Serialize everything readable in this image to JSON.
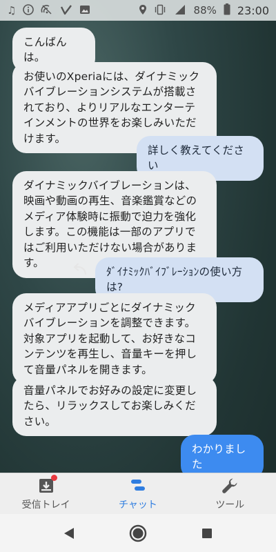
{
  "status_bar": {
    "icons_left": [
      "music-note-icon",
      "info-icon",
      "vpn-icon",
      "signal-v-icon",
      "image-icon"
    ],
    "icons_right": [
      "location-icon",
      "vibrate-icon",
      "cellular-4g-icon"
    ],
    "battery": "88%",
    "time": "23:00"
  },
  "chat": {
    "messages": [
      {
        "from": "bot",
        "text": "こんばんは。"
      },
      {
        "from": "bot",
        "text": "お使いのXperiaには、ダイナミックバイブレーションシステムが搭載されており、よりリアルなエンターテインメントの世界をお楽しみいただけます。"
      },
      {
        "from": "user",
        "text": "詳しく教えてください"
      },
      {
        "from": "bot",
        "text": "ダイナミックバイブレーションは、映画や動画の再生、音楽鑑賞などのメディア体験時に振動で迫力を強化します。この機能は一部のアプリではご利用いただけない場合があります。"
      },
      {
        "from": "user",
        "text": "ﾀﾞｲﾅﾐｯｸﾊﾞｲﾌﾞﾚｰｼｮﾝの使い方は?"
      },
      {
        "from": "bot",
        "text": "メディアアプリごとにダイナミックバイブレーションを調整できます。対象アプリを起動して、お好きなコンテンツを再生し、音量キーを押して音量パネルを開きます。"
      },
      {
        "from": "bot",
        "text": "音量パネルでお好みの設定に変更したら、リラックスしてお楽しみください。"
      },
      {
        "from": "user",
        "text": "わかりました"
      }
    ]
  },
  "tab_bar": {
    "tabs": [
      {
        "label": "受信トレイ",
        "icon": "inbox-icon",
        "active": false,
        "badge": true
      },
      {
        "label": "チャット",
        "icon": "chat-icon",
        "active": true
      },
      {
        "label": "ツール",
        "icon": "wrench-icon",
        "active": false
      }
    ]
  },
  "nav_bar": {
    "buttons": [
      "back-icon",
      "home-icon",
      "recents-icon"
    ]
  },
  "colors": {
    "accent": "#3d8bf0",
    "user_bubble": "#d3e0f3",
    "bot_bubble": "#ebedee",
    "badge": "#e9393f"
  }
}
